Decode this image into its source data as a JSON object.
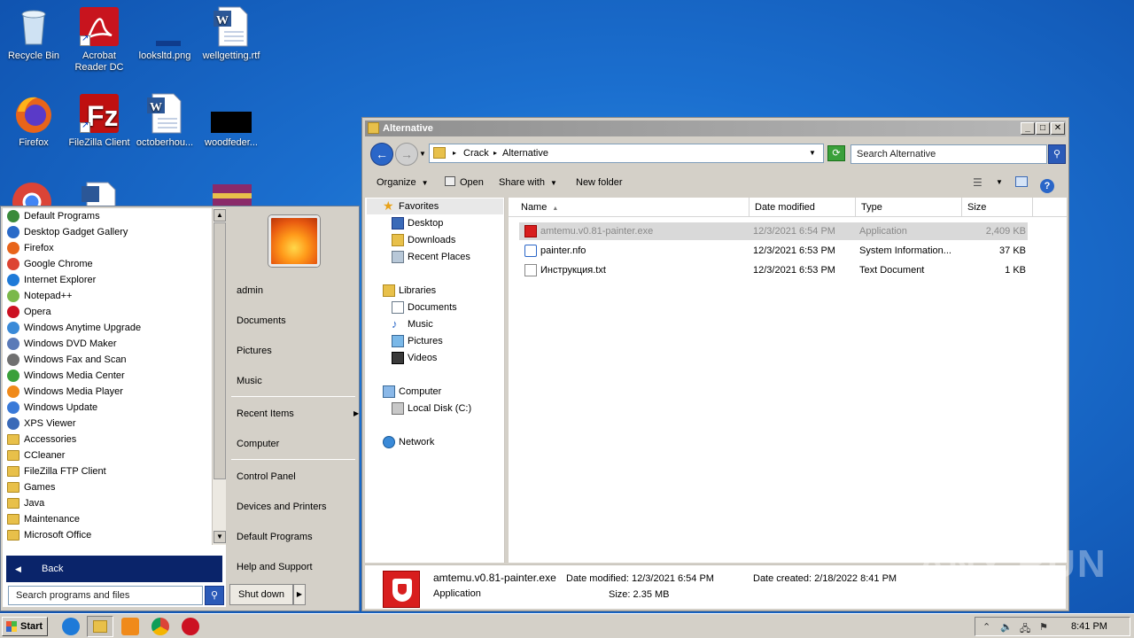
{
  "desktop": {
    "icons": [
      {
        "label": "Recycle Bin",
        "icon": "recycle-bin-icon"
      },
      {
        "label": "Acrobat Reader DC",
        "label_line1": "Acrobat",
        "label_line2": "Reader DC",
        "icon": "acrobat-icon"
      },
      {
        "label": "looksltd.png",
        "icon": "image-file-icon"
      },
      {
        "label": "wellgetting.rtf",
        "icon": "word-doc-icon"
      },
      {
        "label": "Firefox",
        "icon": "firefox-icon"
      },
      {
        "label": "FileZilla Client",
        "icon": "filezilla-icon"
      },
      {
        "label": "octoberhou...",
        "icon": "word-doc-icon"
      },
      {
        "label": "woodfeder...",
        "icon": "black-file-icon"
      }
    ]
  },
  "start_menu": {
    "programs": [
      {
        "label": "Default Programs",
        "icon": "default-programs-icon",
        "color": "#3a8a3a"
      },
      {
        "label": "Desktop Gadget Gallery",
        "icon": "gadget-icon",
        "color": "#2a6ac8"
      },
      {
        "label": "Firefox",
        "icon": "firefox-icon",
        "color": "#e8641a"
      },
      {
        "label": "Google Chrome",
        "icon": "chrome-icon",
        "color": "#dd4433"
      },
      {
        "label": "Internet Explorer",
        "icon": "ie-icon",
        "color": "#1e7ad8"
      },
      {
        "label": "Notepad++",
        "icon": "notepadpp-icon",
        "color": "#7ab84a"
      },
      {
        "label": "Opera",
        "icon": "opera-icon",
        "color": "#cc1122"
      },
      {
        "label": "Windows Anytime Upgrade",
        "icon": "windows-upgrade-icon",
        "color": "#3a8ad8"
      },
      {
        "label": "Windows DVD Maker",
        "icon": "dvd-maker-icon",
        "color": "#5a7ab8"
      },
      {
        "label": "Windows Fax and Scan",
        "icon": "fax-icon",
        "color": "#707070"
      },
      {
        "label": "Windows Media Center",
        "icon": "media-center-icon",
        "color": "#3aa03a"
      },
      {
        "label": "Windows Media Player",
        "icon": "media-player-icon",
        "color": "#f08a1a"
      },
      {
        "label": "Windows Update",
        "icon": "windows-update-icon",
        "color": "#3a7ad8"
      },
      {
        "label": "XPS Viewer",
        "icon": "xps-icon",
        "color": "#3a6ab8"
      },
      {
        "label": "Accessories",
        "icon": "folder-icon"
      },
      {
        "label": "CCleaner",
        "icon": "folder-icon"
      },
      {
        "label": "FileZilla FTP Client",
        "icon": "folder-icon"
      },
      {
        "label": "Games",
        "icon": "folder-icon"
      },
      {
        "label": "Java",
        "icon": "folder-icon"
      },
      {
        "label": "Maintenance",
        "icon": "folder-icon"
      },
      {
        "label": "Microsoft Office",
        "icon": "folder-icon"
      }
    ],
    "back_label": "Back",
    "search_placeholder": "Search programs and files",
    "right": {
      "user": "admin",
      "documents": "Documents",
      "pictures": "Pictures",
      "music": "Music",
      "recent_items": "Recent Items",
      "computer": "Computer",
      "control_panel": "Control Panel",
      "devices_printers": "Devices and Printers",
      "default_programs": "Default Programs",
      "help_support": "Help and Support"
    },
    "shutdown_label": "Shut down"
  },
  "explorer": {
    "title": "Alternative",
    "breadcrumb": [
      "Crack",
      "Alternative"
    ],
    "search_placeholder": "Search Alternative",
    "commands": {
      "organize": "Organize",
      "open": "Open",
      "share_with": "Share with",
      "new_folder": "New folder"
    },
    "nav": {
      "favorites": "Favorites",
      "desktop": "Desktop",
      "downloads": "Downloads",
      "recent_places": "Recent Places",
      "libraries": "Libraries",
      "documents": "Documents",
      "music": "Music",
      "pictures": "Pictures",
      "videos": "Videos",
      "computer": "Computer",
      "local_disk": "Local Disk (C:)",
      "network": "Network"
    },
    "columns": {
      "name": "Name",
      "date_modified": "Date modified",
      "type": "Type",
      "size": "Size"
    },
    "files": [
      {
        "name": "amtemu.v0.81-painter.exe",
        "date": "12/3/2021 6:54 PM",
        "type": "Application",
        "size": "2,409 KB",
        "selected": true,
        "icon": "shield-app-icon"
      },
      {
        "name": "painter.nfo",
        "date": "12/3/2021 6:53 PM",
        "type": "System Information...",
        "size": "37 KB",
        "selected": false,
        "icon": "nfo-file-icon"
      },
      {
        "name": "Инструкция.txt",
        "date": "12/3/2021 6:53 PM",
        "type": "Text Document",
        "size": "1 KB",
        "selected": false,
        "icon": "text-file-icon"
      }
    ],
    "details": {
      "name": "amtemu.v0.81-painter.exe",
      "type": "Application",
      "date_modified_label": "Date modified:",
      "date_modified": "12/3/2021 6:54 PM",
      "size_label": "Size:",
      "size": "2.35 MB",
      "date_created_label": "Date created:",
      "date_created": "2/18/2022 8:41 PM"
    }
  },
  "taskbar": {
    "start_label": "Start",
    "clock": "8:41 PM"
  },
  "watermark": "ANY RUN"
}
